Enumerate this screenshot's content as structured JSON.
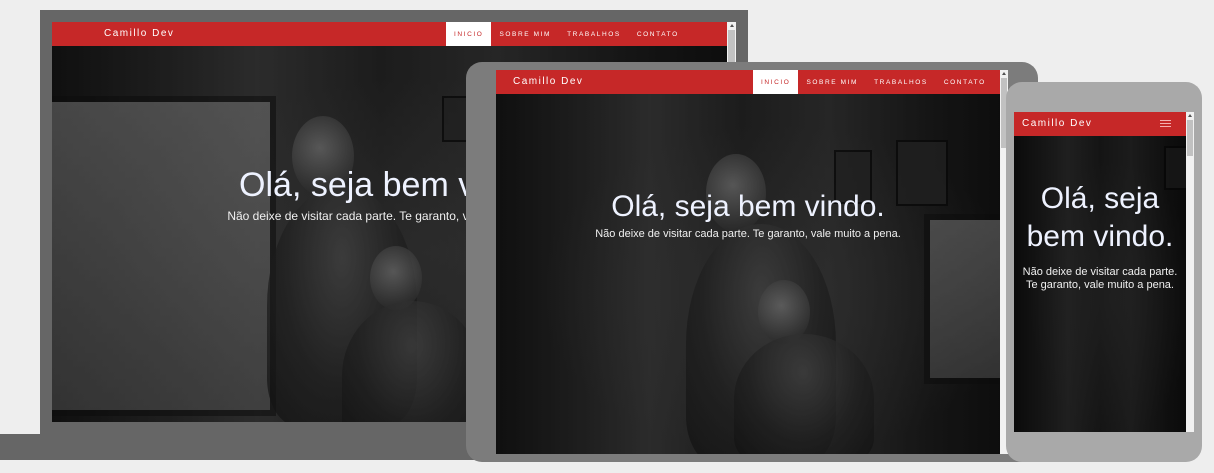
{
  "site": {
    "brand": "Camillo Dev",
    "nav": [
      {
        "label": "INICIO",
        "active": true
      },
      {
        "label": "SOBRE MIM",
        "active": false
      },
      {
        "label": "TRABALHOS",
        "active": false
      },
      {
        "label": "CONTATO",
        "active": false
      }
    ],
    "hero": {
      "title": "Olá, seja bem vindo.",
      "subtitle": "Não deixe de visitar cada parte. Te garanto, vale muito a pena."
    },
    "mobile_menu_icon": "hamburger-menu-icon"
  },
  "colors": {
    "brand_red": "#c62828",
    "background": "#eeeeee",
    "desktop_frame": "#666666",
    "tablet_frame": "#7c7c7c",
    "phone_frame": "#a9a9a9"
  }
}
